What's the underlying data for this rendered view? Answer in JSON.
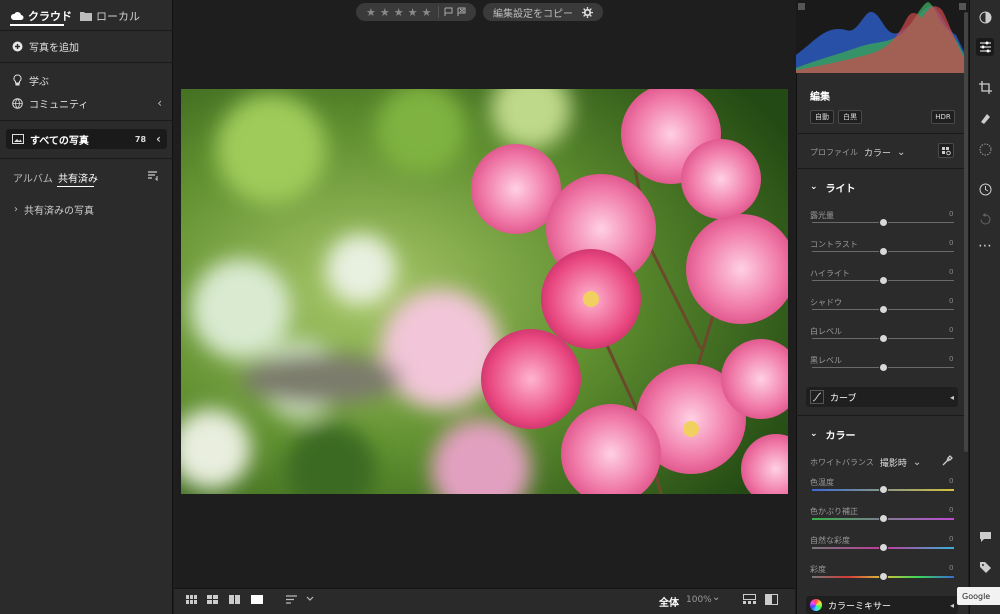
{
  "left": {
    "tabs": [
      {
        "label": "クラウド",
        "active": true
      },
      {
        "label": "ローカル",
        "active": false
      }
    ],
    "add_photos": "写真を追加",
    "learn": "学ぶ",
    "community": "コミュニティ",
    "all_photos": {
      "label": "すべての写真",
      "count": "78"
    },
    "sub_tabs": [
      {
        "label": "アルバム",
        "active": false
      },
      {
        "label": "共有済み",
        "active": true
      }
    ],
    "shared_item": "共有済みの写真"
  },
  "edit": {
    "title": "編集",
    "buttons": {
      "auto": "自動",
      "bw": "白黒",
      "hdr": "HDR"
    },
    "profile_label": "プロファイル",
    "profile_value": "カラー",
    "light": {
      "title": "ライト",
      "sliders": [
        {
          "label": "露光量",
          "value": "0",
          "position": 0.5
        },
        {
          "label": "コントラスト",
          "value": "0",
          "position": 0.5
        },
        {
          "label": "ハイライト",
          "value": "0",
          "position": 0.5
        },
        {
          "label": "シャドウ",
          "value": "0",
          "position": 0.5
        },
        {
          "label": "白レベル",
          "value": "0",
          "position": 0.5
        },
        {
          "label": "黒レベル",
          "value": "0",
          "position": 0.5
        }
      ],
      "curve": "カーブ"
    },
    "color": {
      "title": "カラー",
      "wb_label": "ホワイトバランス",
      "wb_value": "撮影時",
      "sliders": [
        {
          "label": "色温度",
          "value": "0",
          "position": 0.5
        },
        {
          "label": "色かぶり補正",
          "value": "0",
          "position": 0.5
        },
        {
          "label": "自然な彩度",
          "value": "0",
          "position": 0.5
        },
        {
          "label": "彩度",
          "value": "0",
          "position": 0.5
        }
      ],
      "mixer": "カラーミキサー"
    }
  },
  "bottom": {
    "copy_settings": "編集設定をコピー",
    "fit": "全体",
    "zoom": "100%"
  },
  "tooltip": "Google"
}
